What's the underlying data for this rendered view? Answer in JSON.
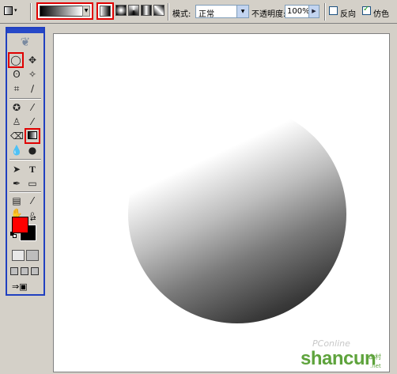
{
  "options_bar": {
    "tool_preset_icon": "gradient-tool-preset-icon",
    "gradient_picker": "gradient-swatch-black-white",
    "gradient_types": [
      "linear",
      "radial",
      "angle",
      "reflected",
      "diamond"
    ],
    "mode_label": "模式:",
    "mode_value": "正常",
    "opacity_label": "不透明度:",
    "opacity_value": "100%",
    "reverse_label": "反向",
    "reverse_checked": false,
    "dither_label": "仿色",
    "dither_checked": true
  },
  "toolbox": {
    "foreground_color": "#ff0000",
    "background_color": "#000000",
    "selected_tools": [
      "elliptical-marquee",
      "gradient"
    ]
  },
  "canvas": {
    "watermark_top": "PConline",
    "watermark_brand": "shancun",
    "watermark_sub": "山村",
    "watermark_url": ".net"
  },
  "colors": {
    "highlight": "#e00000",
    "toolbox_border": "#2040c0"
  }
}
